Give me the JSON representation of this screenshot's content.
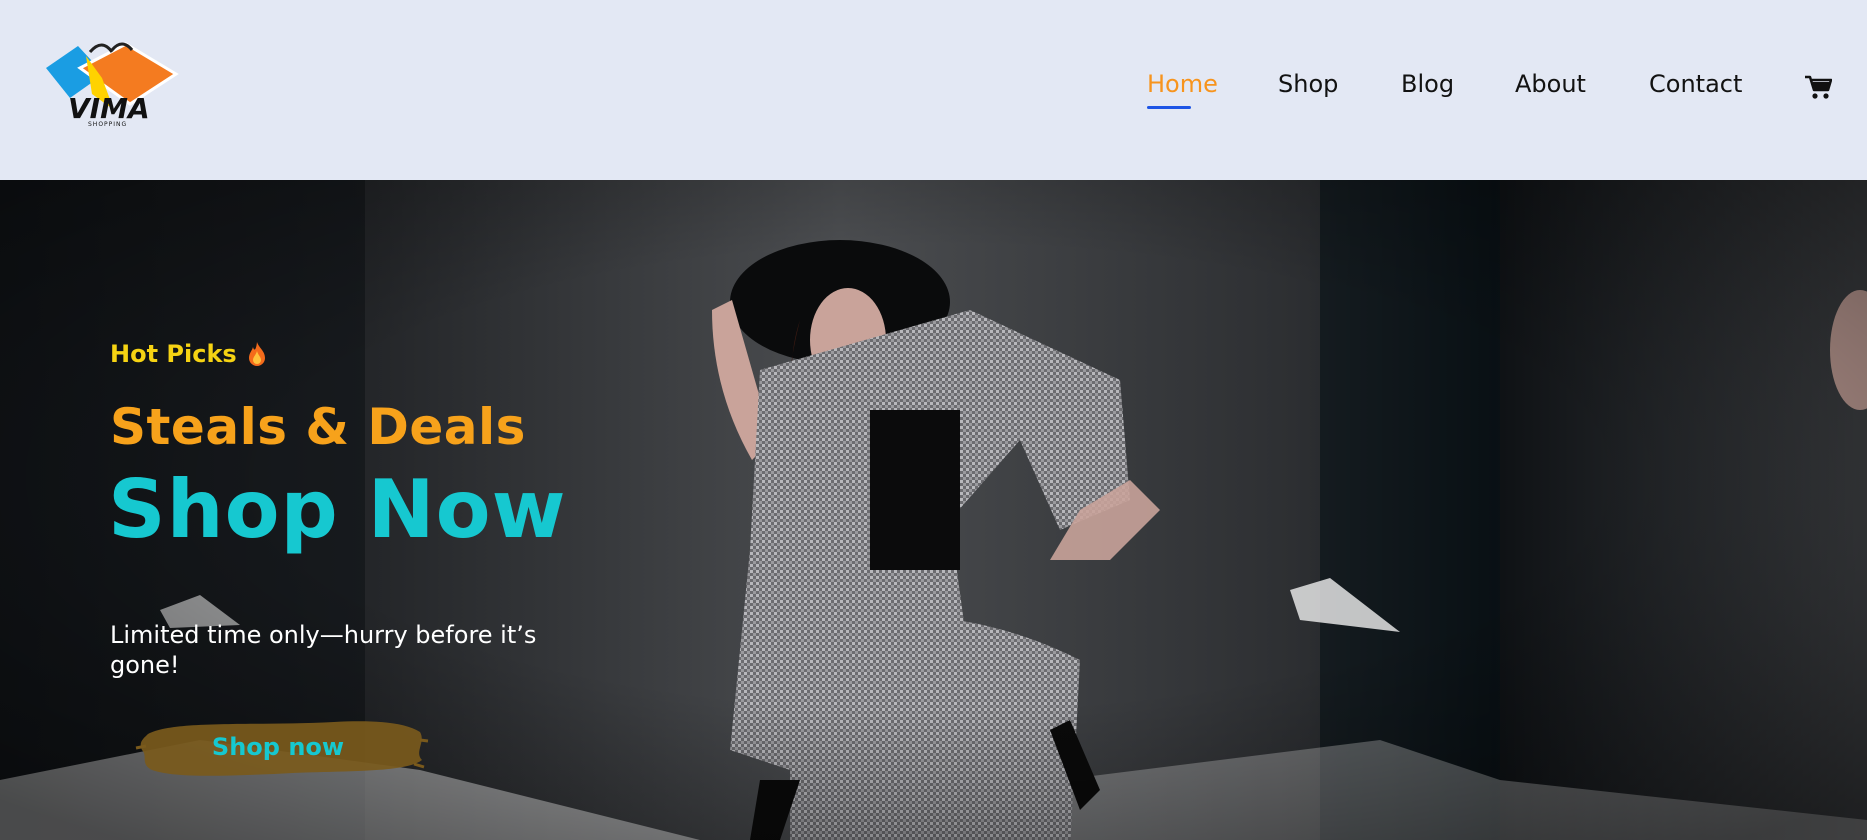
{
  "brand": {
    "logo_text": "VIMA",
    "logo_subtext": "SHOPPING"
  },
  "nav": {
    "items": [
      {
        "label": "Home",
        "active": true
      },
      {
        "label": "Shop",
        "active": false
      },
      {
        "label": "Blog",
        "active": false
      },
      {
        "label": "About",
        "active": false
      },
      {
        "label": "Contact",
        "active": false
      }
    ],
    "cart_icon": "shopping-cart-icon"
  },
  "hero": {
    "eyebrow": "Hot Picks",
    "eyebrow_icon": "fire-icon",
    "headline": "Steals & Deals",
    "title": "Shop Now",
    "tagline": "Limited time only—hurry before it’s gone!",
    "cta_label": "Shop now"
  },
  "colors": {
    "header_bg": "#e3e8f4",
    "nav_active": "#f7941d",
    "nav_underline": "#1e55e6",
    "eyebrow": "#f6d313",
    "headline": "#f7a21b",
    "title": "#16c8d0",
    "cta_brush": "#7a5a1c"
  }
}
